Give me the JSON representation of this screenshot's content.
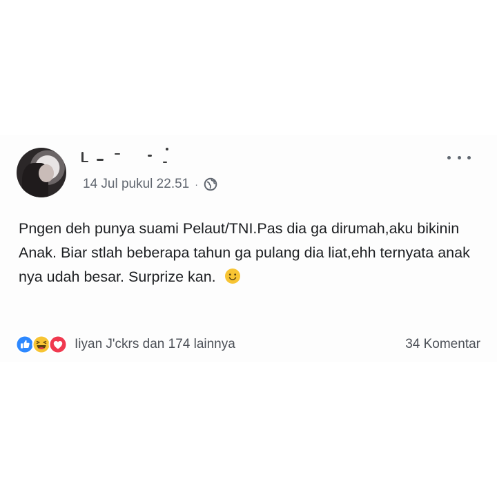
{
  "post": {
    "author_name": "",
    "timestamp": "14 Jul pukul 22.51",
    "separator": "·",
    "privacy_icon": "globe-icon",
    "more_icon": "more-options-icon",
    "text": "Pngen deh punya suami Pelaut/TNI.Pas dia ga dirumah,aku bikinin Anak. Biar stlah beberapa tahun ga pulang dia liat,ehh ternyata anak nya udah besar. Surprize kan.",
    "text_emoji": "smiling-face-icon"
  },
  "reactions": {
    "icons": [
      "like-icon",
      "haha-icon",
      "love-icon"
    ],
    "summary": "Iiyan J'ckrs dan 174 lainnya",
    "comments": "34 Komentar"
  },
  "colors": {
    "like_blue": "#2d88ff",
    "haha_yellow": "#f7c433",
    "love_red": "#f0394f",
    "meta_gray": "#616770",
    "text": "#1c1e21"
  }
}
